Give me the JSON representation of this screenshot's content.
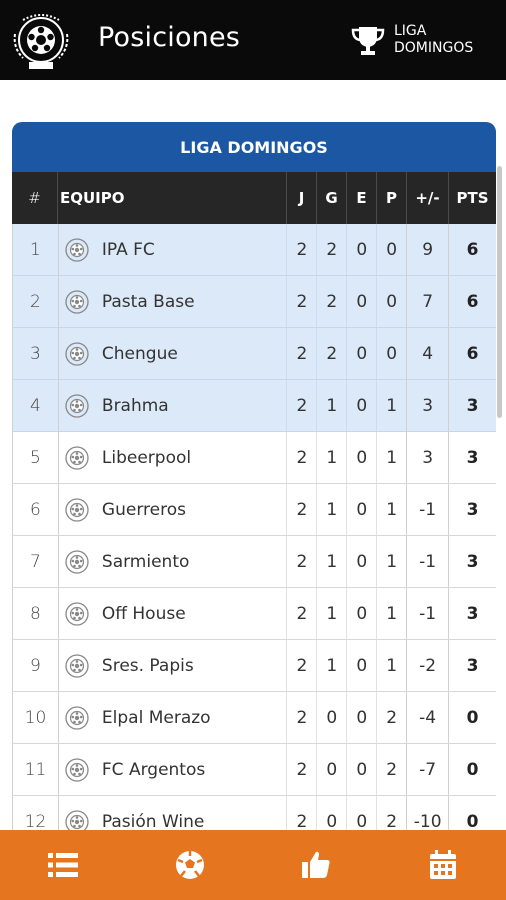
{
  "header": {
    "title": "Posiciones",
    "league_button_label": "LIGA DOMINGOS"
  },
  "standings": {
    "league_title": "LIGA DOMINGOS",
    "columns": [
      "#",
      "EQUIPO",
      "J",
      "G",
      "E",
      "P",
      "+/-",
      "PTS"
    ],
    "rows": [
      {
        "pos": "1",
        "team": "IPA FC",
        "j": "2",
        "g": "2",
        "e": "0",
        "p": "0",
        "diff": "9",
        "pts": "6",
        "highlight": true
      },
      {
        "pos": "2",
        "team": "Pasta Base",
        "j": "2",
        "g": "2",
        "e": "0",
        "p": "0",
        "diff": "7",
        "pts": "6",
        "highlight": true
      },
      {
        "pos": "3",
        "team": "Chengue",
        "j": "2",
        "g": "2",
        "e": "0",
        "p": "0",
        "diff": "4",
        "pts": "6",
        "highlight": true
      },
      {
        "pos": "4",
        "team": "Brahma",
        "j": "2",
        "g": "1",
        "e": "0",
        "p": "1",
        "diff": "3",
        "pts": "3",
        "highlight": true
      },
      {
        "pos": "5",
        "team": "Libeerpool",
        "j": "2",
        "g": "1",
        "e": "0",
        "p": "1",
        "diff": "3",
        "pts": "3",
        "highlight": false
      },
      {
        "pos": "6",
        "team": "Guerreros",
        "j": "2",
        "g": "1",
        "e": "0",
        "p": "1",
        "diff": "-1",
        "pts": "3",
        "highlight": false
      },
      {
        "pos": "7",
        "team": "Sarmiento",
        "j": "2",
        "g": "1",
        "e": "0",
        "p": "1",
        "diff": "-1",
        "pts": "3",
        "highlight": false
      },
      {
        "pos": "8",
        "team": "Off House",
        "j": "2",
        "g": "1",
        "e": "0",
        "p": "1",
        "diff": "-1",
        "pts": "3",
        "highlight": false
      },
      {
        "pos": "9",
        "team": "Sres. Papis",
        "j": "2",
        "g": "1",
        "e": "0",
        "p": "1",
        "diff": "-2",
        "pts": "3",
        "highlight": false
      },
      {
        "pos": "10",
        "team": "Elpal Merazo",
        "j": "2",
        "g": "0",
        "e": "0",
        "p": "2",
        "diff": "-4",
        "pts": "0",
        "highlight": false
      },
      {
        "pos": "11",
        "team": "FC Argentos",
        "j": "2",
        "g": "0",
        "e": "0",
        "p": "2",
        "diff": "-7",
        "pts": "0",
        "highlight": false
      },
      {
        "pos": "12",
        "team": "Pasión Wine",
        "j": "2",
        "g": "0",
        "e": "0",
        "p": "2",
        "diff": "-10",
        "pts": "0",
        "highlight": false
      }
    ]
  },
  "bottom_nav": [
    {
      "name": "standings-list-icon"
    },
    {
      "name": "soccer-ball-icon"
    },
    {
      "name": "thumbs-up-icon"
    },
    {
      "name": "calendar-icon"
    }
  ],
  "colors": {
    "header_bg": "#0a0a0a",
    "league_title_bg": "#1c57a3",
    "table_head_bg": "#262626",
    "highlight_row_bg": "#dce9f8",
    "bottom_nav_bg": "#e5761f"
  }
}
